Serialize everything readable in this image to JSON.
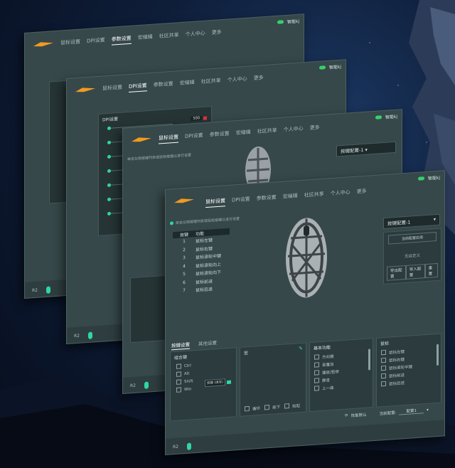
{
  "tabs": [
    "鼠标设置",
    "DPI设置",
    "参数设置",
    "宏编辑",
    "社区共享",
    "个人中心",
    "更多"
  ],
  "tabs_short": [
    "鼠标设置",
    "DPI设置",
    "参数设置",
    "宏编辑",
    "社区共享",
    "个人中心",
    "更多"
  ],
  "back_tabs": [
    "鼠标设置",
    "DPI设置",
    "参数设置",
    "宏编辑",
    "社区共享",
    "个人中心",
    "更多"
  ],
  "titlebar_text": "智能kj",
  "device_label": "R2",
  "dpi_panel_title": "DPI设置",
  "dpi_value": "500",
  "front": {
    "hint": "单击左侧按键列表或鼠标按键以进行设置",
    "table_header": [
      "按键",
      "功能"
    ],
    "rows": [
      {
        "n": "1",
        "f": "鼠标左键"
      },
      {
        "n": "2",
        "f": "鼠标右键"
      },
      {
        "n": "3",
        "f": "鼠标滚轮中键"
      },
      {
        "n": "4",
        "f": "鼠标滚轮向上"
      },
      {
        "n": "5",
        "f": "鼠标滚轮向下"
      },
      {
        "n": "6",
        "f": "鼠标前进"
      },
      {
        "n": "7",
        "f": "鼠标后退"
      }
    ],
    "profile_select": "按键配置-1",
    "apply_all_btn": "当前配置应用",
    "no_custom": "无自定义",
    "btn_export": "导出配置",
    "btn_import": "导入配置",
    "btn_reset": "重置",
    "subtabs": [
      "按键设置",
      "其他设置"
    ],
    "combo_title": "组合键",
    "combo_keys": [
      "Ctrl",
      "Alt",
      "Shift",
      "Win"
    ],
    "combo_input": "按键 (填写)",
    "macro_title": "宏",
    "macro_opts": [
      "循环",
      "按下",
      "抬起"
    ],
    "basic_title": "基本功能",
    "basic_items": [
      "方向键",
      "音量加",
      "播放/暂停",
      "静音",
      "上一曲"
    ],
    "mouse_title": "鼠标",
    "mouse_items": [
      "鼠标左键",
      "鼠标右键",
      "鼠标滚轮中键",
      "鼠标前进",
      "鼠标后退"
    ],
    "restore": "恢复默认",
    "current_cfg_label": "当前配置:",
    "current_cfg_value": "配置1"
  },
  "colors": {
    "window_bg": "#36484a",
    "accent_green": "#2fd7a3",
    "toggle_green": "#35d16a",
    "logo_orange": "#f29a1f",
    "dpi_red": "#e0303a"
  }
}
